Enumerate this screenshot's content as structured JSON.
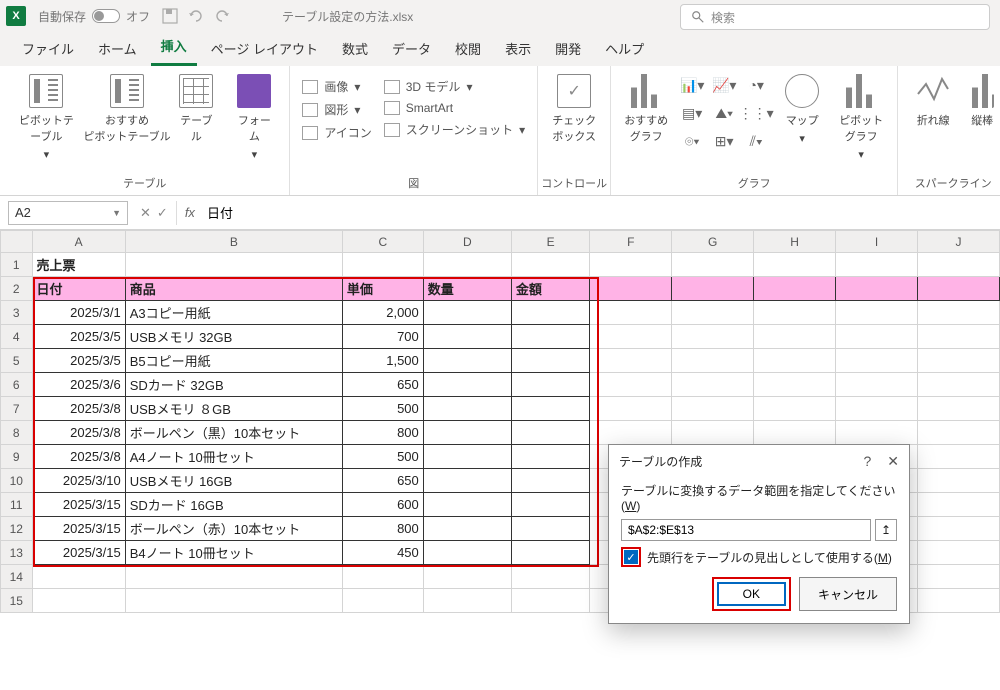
{
  "title": {
    "autosave": "自動保存",
    "autosave_state": "オフ",
    "filename": "テーブル設定の方法.xlsx",
    "search_placeholder": "検索"
  },
  "tabs": [
    "ファイル",
    "ホーム",
    "挿入",
    "ページ レイアウト",
    "数式",
    "データ",
    "校閲",
    "表示",
    "開発",
    "ヘルプ"
  ],
  "active_tab": 2,
  "ribbon": {
    "g_table": {
      "label": "テーブル",
      "pivot": "ピボットテーブル",
      "recpivot": "おすすめ\nピボットテーブル",
      "table": "テーブル",
      "form": "フォーム"
    },
    "g_illust": {
      "label": "図",
      "pic": "画像",
      "shape": "図形",
      "icon": "アイコン",
      "model3d": "3D モデル",
      "smartart": "SmartArt",
      "screenshot": "スクリーンショット"
    },
    "g_ctrl": {
      "label": "コントロール",
      "checkbox": "チェック\nボックス"
    },
    "g_chart": {
      "label": "グラフ",
      "rec": "おすすめ\nグラフ",
      "map": "マップ",
      "pivotchart": "ピボットグラフ"
    },
    "g_spark": {
      "label": "スパークライン",
      "line": "折れ線",
      "col": "縦棒"
    }
  },
  "fbar": {
    "name": "A2",
    "value": "日付"
  },
  "cols": [
    "A",
    "B",
    "C",
    "D",
    "E",
    "F",
    "G",
    "H",
    "I",
    "J"
  ],
  "row_count": 15,
  "sheet_title": "売上票",
  "headers": [
    "日付",
    "商品",
    "単価",
    "数量",
    "金額"
  ],
  "rows": [
    {
      "date": "2025/3/1",
      "item": "A3コピー用紙",
      "price": "2,000"
    },
    {
      "date": "2025/3/5",
      "item": "USBメモリ 32GB",
      "price": "700"
    },
    {
      "date": "2025/3/5",
      "item": "B5コピー用紙",
      "price": "1,500"
    },
    {
      "date": "2025/3/6",
      "item": "SDカード 32GB",
      "price": "650"
    },
    {
      "date": "2025/3/8",
      "item": "USBメモリ ８GB",
      "price": "500"
    },
    {
      "date": "2025/3/8",
      "item": "ボールペン（黒）10本セット",
      "price": "800"
    },
    {
      "date": "2025/3/8",
      "item": "A4ノート 10冊セット",
      "price": "500"
    },
    {
      "date": "2025/3/10",
      "item": "USBメモリ 16GB",
      "price": "650"
    },
    {
      "date": "2025/3/15",
      "item": "SDカード 16GB",
      "price": "600"
    },
    {
      "date": "2025/3/15",
      "item": "ボールペン（赤）10本セット",
      "price": "800"
    },
    {
      "date": "2025/3/15",
      "item": "B4ノート 10冊セット",
      "price": "450"
    }
  ],
  "dialog": {
    "title": "テーブルの作成",
    "prompt_pre": "テーブルに変換するデータ範囲を指定してください(",
    "prompt_key": "W",
    "range": "$A$2:$E$13",
    "header_check_pre": "先頭行をテーブルの見出しとして使用する(",
    "header_check_key": "M",
    "ok": "OK",
    "cancel": "キャンセル"
  }
}
